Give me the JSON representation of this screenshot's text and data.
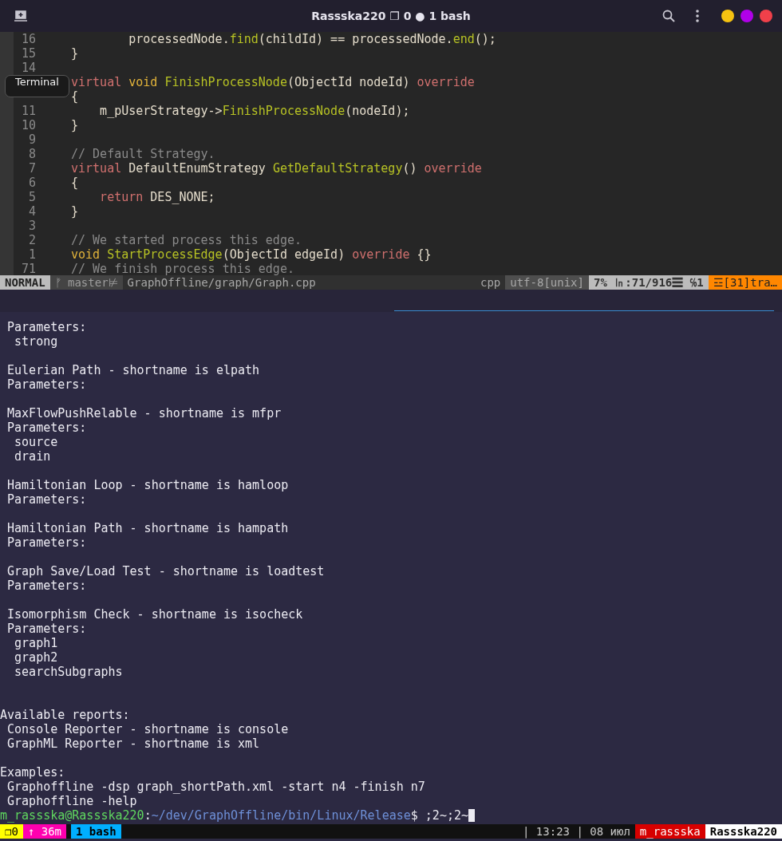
{
  "window": {
    "title": "Rassska220 ❐ 0 ● 1 bash"
  },
  "tooltip": "Terminal",
  "editor": {
    "lines": [
      {
        "number": "16",
        "tokens": [
          {
            "kind": "plain",
            "text": "        processedNode."
          },
          {
            "kind": "func",
            "text": "find"
          },
          {
            "kind": "plain",
            "text": "(childId) == processedNode."
          },
          {
            "kind": "func",
            "text": "end"
          },
          {
            "kind": "plain",
            "text": "();"
          }
        ]
      },
      {
        "number": "15",
        "tokens": [
          {
            "kind": "plain",
            "text": "}"
          }
        ]
      },
      {
        "number": "14"
      },
      {
        "tokens": [
          {
            "kind": "keyword",
            "text": "virtual"
          },
          {
            "kind": "type",
            "text": " void"
          },
          {
            "kind": "func",
            "text": " FinishProcessNode"
          },
          {
            "kind": "plain",
            "text": "(ObjectId nodeId) "
          },
          {
            "kind": "keyword",
            "text": "override"
          }
        ]
      },
      {
        "tokens": [
          {
            "kind": "plain",
            "text": "{"
          }
        ]
      },
      {
        "number": "11",
        "tokens": [
          {
            "kind": "plain",
            "text": "    m_pUserStrategy->"
          },
          {
            "kind": "func",
            "text": "FinishProcessNode"
          },
          {
            "kind": "plain",
            "text": "(nodeId);"
          }
        ]
      },
      {
        "number": "10",
        "tokens": [
          {
            "kind": "plain",
            "text": "}"
          }
        ]
      },
      {
        "number": "9"
      },
      {
        "number": "8",
        "tokens": [
          {
            "kind": "comment",
            "text": "// Default Strategy."
          }
        ]
      },
      {
        "number": "7",
        "tokens": [
          {
            "kind": "keyword",
            "text": "virtual"
          },
          {
            "kind": "plain",
            "text": " DefaultEnumStrategy "
          },
          {
            "kind": "func",
            "text": "GetDefaultStrategy"
          },
          {
            "kind": "plain",
            "text": "() "
          },
          {
            "kind": "keyword",
            "text": "override"
          }
        ]
      },
      {
        "number": "6",
        "tokens": [
          {
            "kind": "plain",
            "text": "{"
          }
        ]
      },
      {
        "number": "5",
        "tokens": [
          {
            "kind": "keyword",
            "text": "    return"
          },
          {
            "kind": "plain",
            "text": " DES_NONE;"
          }
        ]
      },
      {
        "number": "4",
        "tokens": [
          {
            "kind": "plain",
            "text": "}"
          }
        ]
      },
      {
        "number": "3"
      },
      {
        "number": "2",
        "tokens": [
          {
            "kind": "comment",
            "text": "// We started process this edge."
          }
        ]
      },
      {
        "number": "1",
        "tokens": [
          {
            "kind": "type",
            "text": "void"
          },
          {
            "kind": "func",
            "text": " StartProcessEdge"
          },
          {
            "kind": "plain",
            "text": "(ObjectId edgeId) "
          },
          {
            "kind": "keyword",
            "text": "override"
          },
          {
            "kind": "plain",
            "text": " {}"
          }
        ]
      },
      {
        "number": "71",
        "tokens": [
          {
            "kind": "comment",
            "text": "// We finish process this edge."
          }
        ]
      }
    ],
    "status_line": [
      {
        "kind": "mode",
        "text": "NORMAL"
      },
      {
        "kind": "branch",
        "text": "ᚠ master⊭"
      },
      {
        "kind": "file",
        "text": "GraphOffline/graph/Graph.cpp"
      },
      {
        "kind": "filetype",
        "text": "cpp"
      },
      {
        "kind": "encoding",
        "text": "utf-8[unix]"
      },
      {
        "kind": "position",
        "text": "7% ㏑:71/916☰ ℅1"
      },
      {
        "kind": "warning",
        "text": "☲[31]tra…"
      }
    ]
  },
  "terminal": {
    "lines": [
      {
        "kind": "text",
        "text": " Parameters:"
      },
      {
        "kind": "text",
        "text": "  strong"
      },
      {
        "kind": "blank"
      },
      {
        "kind": "text",
        "text": " Eulerian Path - shortname is elpath"
      },
      {
        "kind": "text",
        "text": " Parameters:"
      },
      {
        "kind": "blank"
      },
      {
        "kind": "text",
        "text": " MaxFlowPushRelable - shortname is mfpr"
      },
      {
        "kind": "text",
        "text": " Parameters:"
      },
      {
        "kind": "text",
        "text": "  source"
      },
      {
        "kind": "text",
        "text": "  drain"
      },
      {
        "kind": "blank"
      },
      {
        "kind": "text",
        "text": " Hamiltonian Loop - shortname is hamloop"
      },
      {
        "kind": "text",
        "text": " Parameters:"
      },
      {
        "kind": "blank"
      },
      {
        "kind": "text",
        "text": " Hamiltonian Path - shortname is hampath"
      },
      {
        "kind": "text",
        "text": " Parameters:"
      },
      {
        "kind": "blank"
      },
      {
        "kind": "text",
        "text": " Graph Save/Load Test - shortname is loadtest"
      },
      {
        "kind": "text",
        "text": " Parameters:"
      },
      {
        "kind": "blank"
      },
      {
        "kind": "text",
        "text": " Isomorphism Check - shortname is isocheck"
      },
      {
        "kind": "text",
        "text": " Parameters:"
      },
      {
        "kind": "text",
        "text": "  graph1"
      },
      {
        "kind": "text",
        "text": "  graph2"
      },
      {
        "kind": "text",
        "text": "  searchSubgraphs"
      },
      {
        "kind": "blank"
      },
      {
        "kind": "blank"
      },
      {
        "kind": "text",
        "text": "Available reports:"
      },
      {
        "kind": "text",
        "text": " Console Reporter - shortname is console"
      },
      {
        "kind": "text",
        "text": " GraphML Reporter - shortname is xml"
      },
      {
        "kind": "blank"
      },
      {
        "kind": "text",
        "text": "Examples:"
      },
      {
        "kind": "text",
        "text": " Graphoffline -dsp graph_shortPath.xml -start n4 -finish n7"
      },
      {
        "kind": "text",
        "text": " Graphoffline -help"
      }
    ],
    "prompt": {
      "user_host": "m_rassska@Rassska220",
      "separator": ":",
      "path": "~/dev/GraphOffline/bin/Linux/Release",
      "input": "$ ;2~;2~"
    }
  },
  "tmux_bar": {
    "left": [
      {
        "kind": "session",
        "text": "❐0"
      },
      {
        "kind": "uptime",
        "text": "↑ 36m"
      },
      {
        "kind": "window",
        "text": "1 bash"
      }
    ],
    "right": [
      {
        "kind": "plain",
        "text": "| 13:23 | 08 июл"
      },
      {
        "kind": "user",
        "text": "m_rassska"
      },
      {
        "kind": "host",
        "text": "Rassska220"
      }
    ]
  }
}
